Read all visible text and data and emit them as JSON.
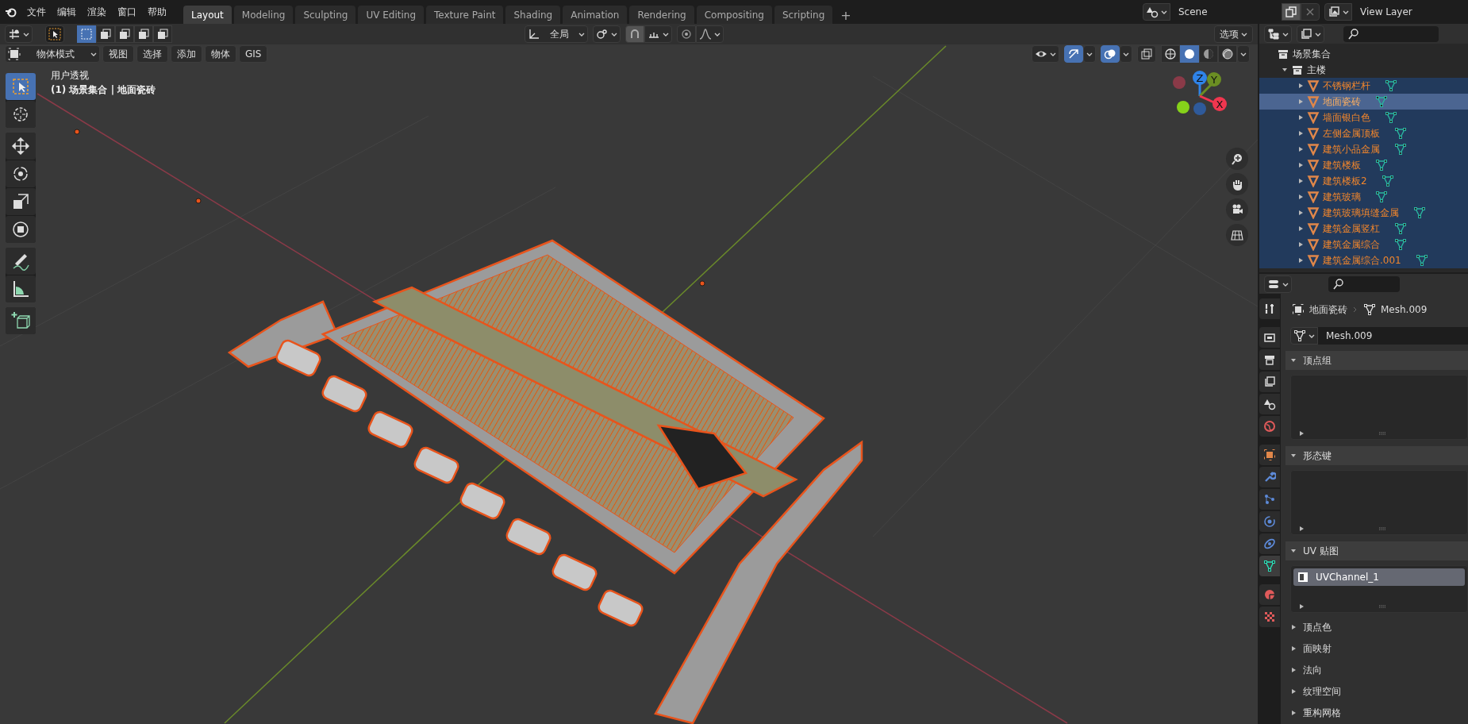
{
  "top_bar": {
    "menus": [
      "文件",
      "编辑",
      "渲染",
      "窗口",
      "帮助"
    ],
    "workspace_tabs": [
      {
        "label": "Layout",
        "selected": true
      },
      {
        "label": "Modeling",
        "selected": false
      },
      {
        "label": "Sculpting",
        "selected": false
      },
      {
        "label": "UV Editing",
        "selected": false
      },
      {
        "label": "Texture Paint",
        "selected": false
      },
      {
        "label": "Shading",
        "selected": false
      },
      {
        "label": "Animation",
        "selected": false
      },
      {
        "label": "Rendering",
        "selected": false
      },
      {
        "label": "Compositing",
        "selected": false
      },
      {
        "label": "Scripting",
        "selected": false
      }
    ],
    "add_tab": "+",
    "scene": "Scene",
    "view_layer": "View Layer"
  },
  "viewport": {
    "select_modes": [
      {
        "selected": true
      },
      {
        "selected": false
      },
      {
        "selected": false
      },
      {
        "selected": false
      },
      {
        "selected": false
      }
    ],
    "transform_orientation": "全局",
    "options": "选项",
    "mode": "物体模式",
    "menus": [
      "视图",
      "选择",
      "添加",
      "物体",
      "GIS"
    ],
    "view_name": "用户透视",
    "object_info": "(1) 场景集合 | 地面瓷砖",
    "tools": [
      {
        "kind": "select",
        "selected": true
      },
      {
        "kind": "cursor",
        "selected": false
      },
      {
        "kind": "move",
        "selected": false
      },
      {
        "kind": "rotate",
        "selected": false
      },
      {
        "kind": "scale",
        "selected": false
      },
      {
        "kind": "transform",
        "selected": false
      },
      {
        "kind": "annotate",
        "selected": false
      },
      {
        "kind": "measure",
        "selected": false
      },
      {
        "kind": "add_cube",
        "selected": false
      }
    ],
    "axes": [
      {
        "label": "Z"
      },
      {
        "label": "Y"
      },
      {
        "label": "X"
      }
    ],
    "shading_modes": [
      {
        "selected": false
      },
      {
        "selected": true
      },
      {
        "selected": false
      },
      {
        "selected": false
      }
    ]
  },
  "outliner": {
    "root": "场景集合",
    "collections": [
      {
        "name": "主楼",
        "expanded": true,
        "children": [
          {
            "name": "不锈钢栏杆",
            "selected": true,
            "active": false
          },
          {
            "name": "地面瓷砖",
            "selected": true,
            "active": true
          },
          {
            "name": "墙面银白色",
            "selected": true,
            "active": false
          },
          {
            "name": "左侧金属顶板",
            "selected": true,
            "active": false
          },
          {
            "name": "建筑小品金属",
            "selected": true,
            "active": false
          },
          {
            "name": "建筑楼板",
            "selected": true,
            "active": false
          },
          {
            "name": "建筑楼板2",
            "selected": true,
            "active": false
          },
          {
            "name": "建筑玻璃",
            "selected": true,
            "active": false
          },
          {
            "name": "建筑玻璃填缝金属",
            "selected": true,
            "active": false
          },
          {
            "name": "建筑金属竖杠",
            "selected": true,
            "active": false
          },
          {
            "name": "建筑金属综合",
            "selected": true,
            "active": false
          },
          {
            "name": "建筑金属综合.001",
            "selected": true,
            "active": false
          }
        ]
      }
    ]
  },
  "properties": {
    "tabs": [
      {
        "kind": "tool",
        "selected": false
      },
      {
        "kind": "render",
        "selected": false
      },
      {
        "kind": "output",
        "selected": false
      },
      {
        "kind": "view_layer",
        "selected": false
      },
      {
        "kind": "scene",
        "selected": false
      },
      {
        "kind": "world",
        "selected": false
      },
      {
        "kind": "object",
        "selected": false
      },
      {
        "kind": "modifiers",
        "selected": false
      },
      {
        "kind": "particles",
        "selected": false
      },
      {
        "kind": "physics",
        "selected": false
      },
      {
        "kind": "constraints",
        "selected": false
      },
      {
        "kind": "data",
        "selected": true
      },
      {
        "kind": "material",
        "selected": false
      },
      {
        "kind": "texture",
        "selected": false
      }
    ],
    "object_name": "地面瓷砖",
    "mesh_name": "Mesh.009",
    "datablock": "Mesh.009",
    "panels": [
      {
        "title": "顶点组",
        "expanded": true
      },
      {
        "title": "形态键",
        "expanded": true
      },
      {
        "title": "UV 贴图",
        "expanded": true,
        "items": [
          {
            "name": "UVChannel_1",
            "selected": true
          }
        ]
      },
      {
        "title": "顶点色",
        "expanded": false
      },
      {
        "title": "面映射",
        "expanded": false
      },
      {
        "title": "法向",
        "expanded": false
      },
      {
        "title": "纹理空间",
        "expanded": false
      },
      {
        "title": "重构网格",
        "expanded": false
      }
    ]
  }
}
